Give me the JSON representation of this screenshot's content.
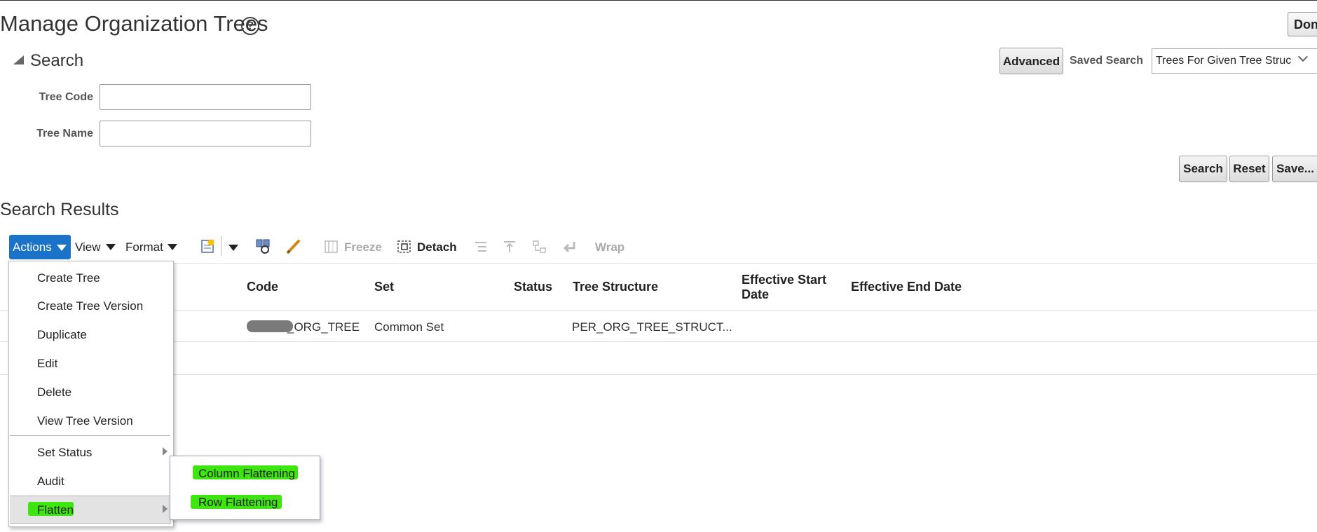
{
  "page": {
    "title": "Manage Organization Trees",
    "done_label": "Done"
  },
  "search": {
    "heading": "Search",
    "advanced_label": "Advanced",
    "saved_search_label": "Saved Search",
    "saved_search_value": "Trees For Given Tree Struc",
    "fields": [
      {
        "label": "Tree Code",
        "value": ""
      },
      {
        "label": "Tree Name",
        "value": ""
      }
    ],
    "buttons": {
      "search": "Search",
      "reset": "Reset",
      "save": "Save..."
    }
  },
  "results": {
    "title": "Search Results",
    "toolbar": {
      "actions": "Actions",
      "view": "View",
      "format": "Format",
      "freeze": "Freeze",
      "detach": "Detach",
      "wrap": "Wrap"
    },
    "columns": [
      "Code",
      "Set",
      "Status",
      "Tree Structure",
      "Effective Start Date",
      "Effective End Date"
    ],
    "rows": [
      {
        "code": "_ORG_TREE",
        "set": "Common Set",
        "status": "",
        "tree_structure": "PER_ORG_TREE_STRUCT...",
        "start": "",
        "end": ""
      }
    ]
  },
  "actions_menu": {
    "items": [
      "Create Tree",
      "Create Tree Version",
      "Duplicate",
      "Edit",
      "Delete",
      "View Tree Version",
      "Set Status",
      "Audit",
      "Flatten"
    ],
    "flatten_submenu": [
      "Column Flattening",
      "Row Flattening"
    ]
  },
  "colors": {
    "accent": "#1a73c8",
    "highlight": "#3ee610"
  }
}
